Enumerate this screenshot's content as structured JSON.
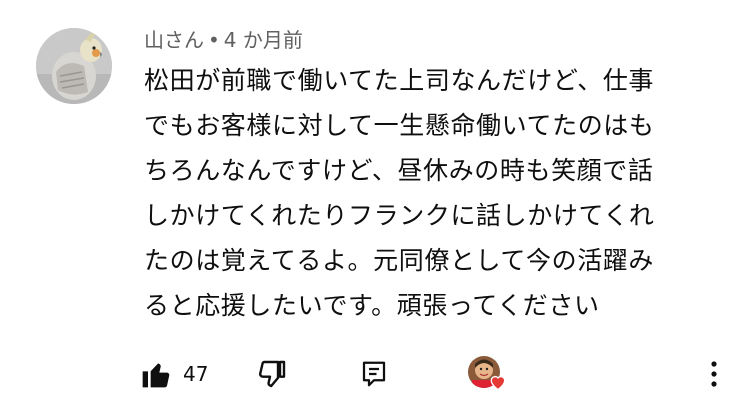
{
  "comment": {
    "author": "山さん",
    "separator": "•",
    "time": "4 か月前",
    "lines": [
      "松田が前職で働いてた上司なんだけど、仕事",
      "でもお客様に対して一生懸命働いてたのはも",
      "ちろんなんですけど、昼休みの時も笑顔で話",
      "しかけてくれたりフランクに話しかけてくれ",
      "たのは覚えてるよ。元同僚として今の活躍み",
      "ると応援したいです。頑張ってください"
    ]
  },
  "actions": {
    "like_count": "47",
    "icons": {
      "like": "thumb-up-icon",
      "dislike": "thumb-down-icon",
      "reply": "reply-icon",
      "creator_heart": "creator-heart-icon",
      "more": "more-vertical-icon"
    }
  },
  "colors": {
    "text": "#0f0f0f",
    "meta": "#606060",
    "heart": "#e53935"
  }
}
